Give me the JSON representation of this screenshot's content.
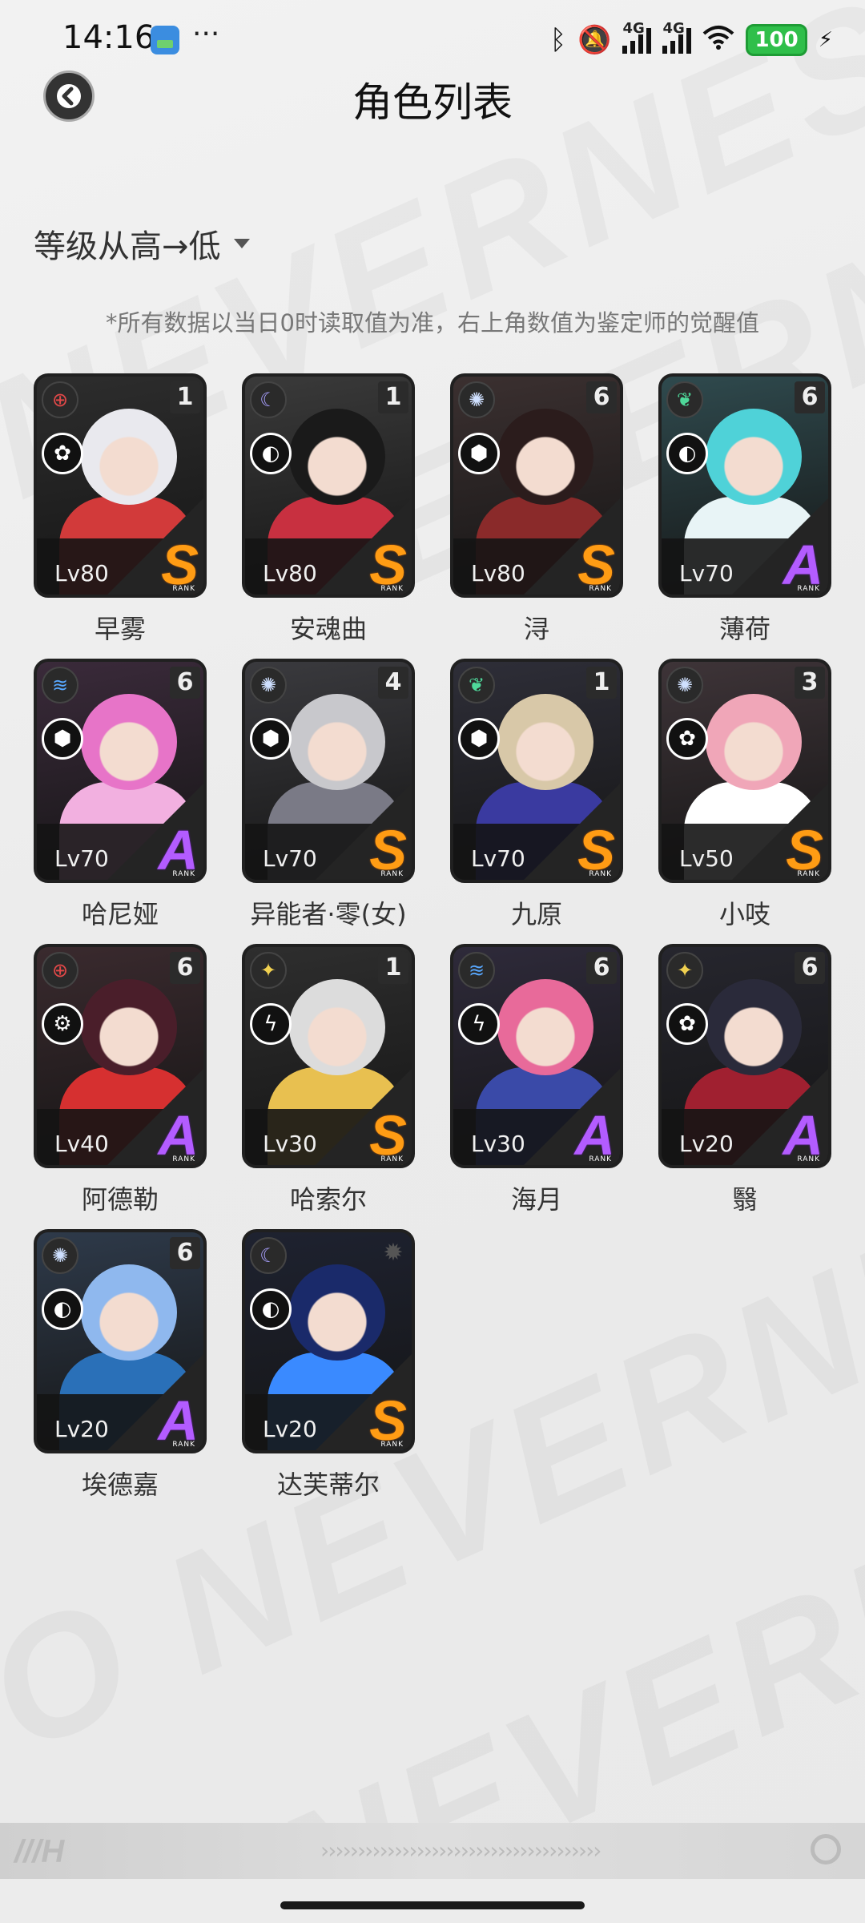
{
  "status_bar": {
    "time": "14:16",
    "dots": "···",
    "network_1": "4G",
    "network_2": "4G",
    "battery": "100"
  },
  "nav": {
    "title": "角色列表"
  },
  "sort": {
    "label": "等级从高→低"
  },
  "note": "*所有数据以当日0时读取值为准，右上角数值为鉴定师的觉醒值",
  "rank_caption": "RANK",
  "characters": [
    {
      "name": "早雾",
      "level": "Lv80",
      "rank": "S",
      "awaken": "1",
      "element_icon": "crosshair-icon",
      "role_icon": "swirl-icon",
      "colors": {
        "hair": "#e9e9ee",
        "accent": "#d23a3a",
        "bg": "#2d2d2d"
      }
    },
    {
      "name": "安魂曲",
      "level": "Lv80",
      "rank": "S",
      "awaken": "1",
      "element_icon": "moon-icon",
      "role_icon": "crescent-icon",
      "colors": {
        "hair": "#1a1a1a",
        "accent": "#c83040",
        "bg": "#3a3a3a"
      }
    },
    {
      "name": "浔",
      "level": "Lv80",
      "rank": "S",
      "awaken": "6",
      "element_icon": "sun-icon",
      "role_icon": "cube-icon",
      "colors": {
        "hair": "#2b1c1c",
        "accent": "#8a2a2a",
        "bg": "#3b3030"
      }
    },
    {
      "name": "薄荷",
      "level": "Lv70",
      "rank": "A",
      "awaken": "6",
      "element_icon": "leaf-icon",
      "role_icon": "crescent-icon",
      "colors": {
        "hair": "#4fd2d8",
        "accent": "#e8f4f6",
        "bg": "#2f4a4e"
      }
    },
    {
      "name": "哈尼娅",
      "level": "Lv70",
      "rank": "A",
      "awaken": "6",
      "element_icon": "wave-icon",
      "role_icon": "cube-icon",
      "colors": {
        "hair": "#e774c8",
        "accent": "#f2b0e0",
        "bg": "#3a2a3a"
      }
    },
    {
      "name": "异能者·零(女)",
      "level": "Lv70",
      "rank": "S",
      "awaken": "4",
      "element_icon": "sun-icon",
      "role_icon": "cube-icon",
      "colors": {
        "hair": "#c8c8cc",
        "accent": "#7a7a86",
        "bg": "#3a3a3e"
      }
    },
    {
      "name": "九原",
      "level": "Lv70",
      "rank": "S",
      "awaken": "1",
      "element_icon": "leaf-icon",
      "role_icon": "cube-icon",
      "colors": {
        "hair": "#d8c8a8",
        "accent": "#3a3aa0",
        "bg": "#2e2e38"
      }
    },
    {
      "name": "小吱",
      "level": "Lv50",
      "rank": "S",
      "awaken": "3",
      "element_icon": "sun-icon",
      "role_icon": "swirl-icon",
      "colors": {
        "hair": "#f0a6b8",
        "accent": "#ffffff",
        "bg": "#3e3438"
      }
    },
    {
      "name": "阿德勒",
      "level": "Lv40",
      "rank": "A",
      "awaken": "6",
      "element_icon": "crosshair-icon",
      "role_icon": "gear-icon",
      "colors": {
        "hair": "#4a1e2a",
        "accent": "#d63030",
        "bg": "#3a2a2e"
      }
    },
    {
      "name": "哈索尔",
      "level": "Lv30",
      "rank": "S",
      "awaken": "1",
      "element_icon": "star-icon",
      "role_icon": "lightning-icon",
      "colors": {
        "hair": "#dcdcdc",
        "accent": "#e8c050",
        "bg": "#2e2e2e"
      }
    },
    {
      "name": "海月",
      "level": "Lv30",
      "rank": "A",
      "awaken": "6",
      "element_icon": "wave-icon",
      "role_icon": "lightning-icon",
      "colors": {
        "hair": "#e86a9a",
        "accent": "#3a4aa8",
        "bg": "#2e2a3a"
      }
    },
    {
      "name": "翳",
      "level": "Lv20",
      "rank": "A",
      "awaken": "6",
      "element_icon": "star-icon",
      "role_icon": "swirl-icon",
      "colors": {
        "hair": "#2a2a3a",
        "accent": "#a02030",
        "bg": "#26262e"
      }
    },
    {
      "name": "埃德嘉",
      "level": "Lv20",
      "rank": "A",
      "awaken": "6",
      "element_icon": "sun-icon",
      "role_icon": "crescent-icon",
      "colors": {
        "hair": "#8fb8ee",
        "accent": "#2a70b8",
        "bg": "#2e3a4a"
      }
    },
    {
      "name": "达芙蒂尔",
      "level": "Lv20",
      "rank": "S",
      "awaken": "",
      "element_icon": "moon-icon",
      "role_icon": "crescent-icon",
      "colors": {
        "hair": "#1a2a6a",
        "accent": "#3a8aff",
        "bg": "#1e2230"
      }
    }
  ]
}
